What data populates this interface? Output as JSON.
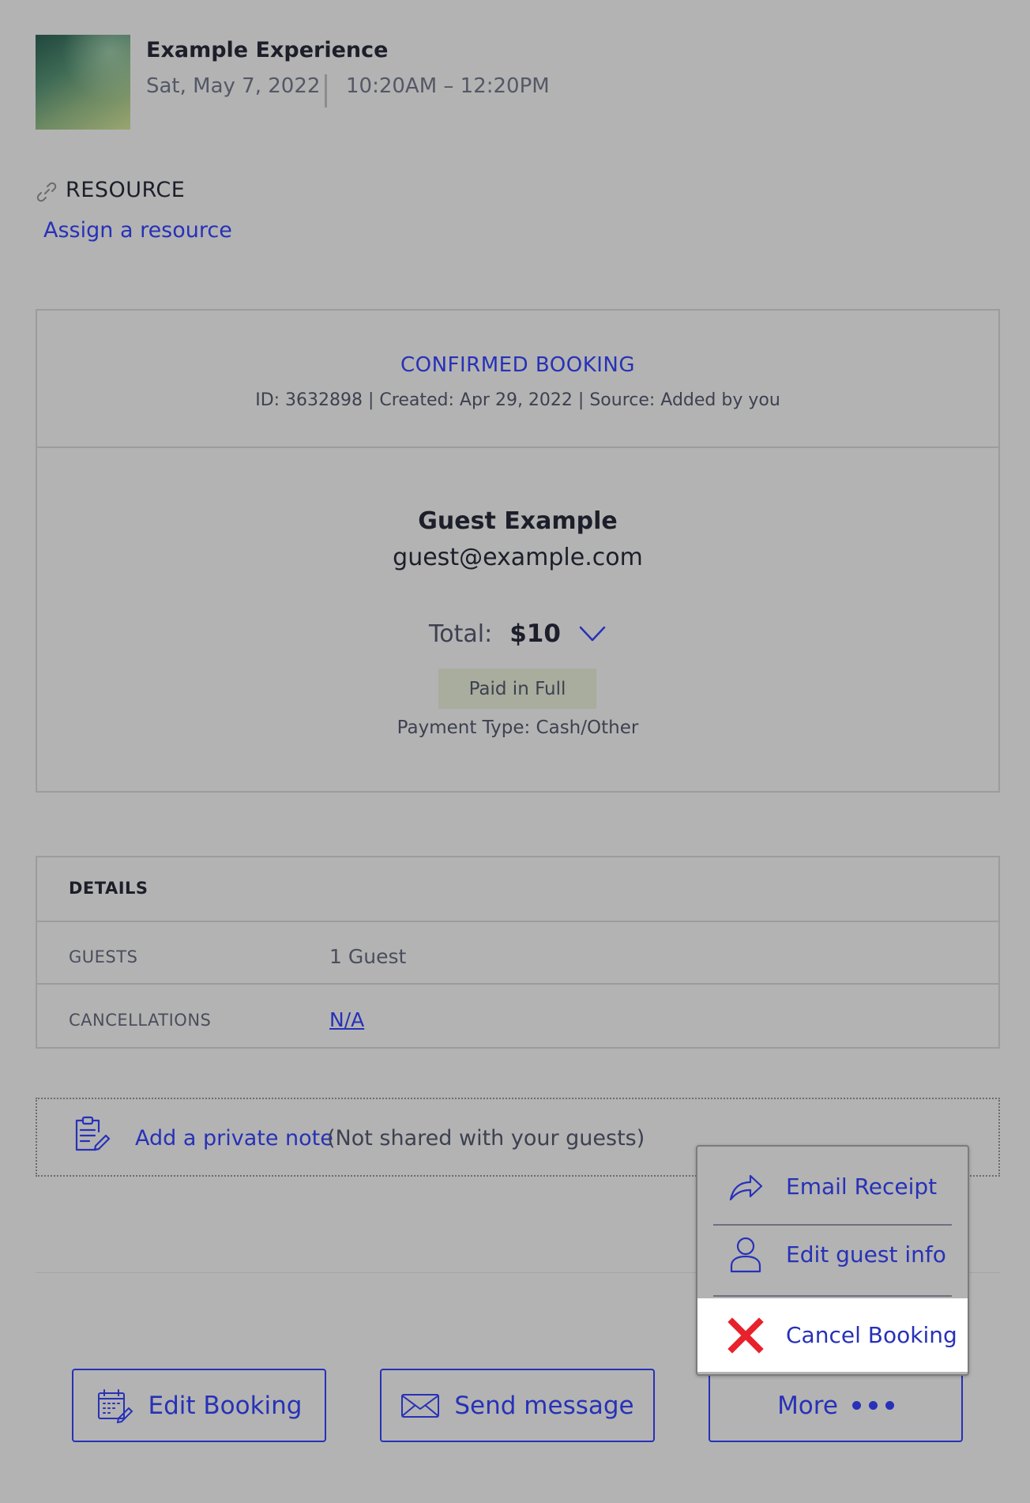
{
  "experience": {
    "title": "Example Experience",
    "date": "Sat, May 7, 2022",
    "time": "10:20AM – 12:20PM"
  },
  "resource": {
    "label": "RESOURCE",
    "link": "Assign a resource"
  },
  "booking": {
    "status": "CONFIRMED BOOKING",
    "meta": "ID: 3632898 | Created: Apr 29, 2022 | Source: Added by you",
    "guest_name": "Guest Example",
    "guest_email": "guest@example.com",
    "total_label": "Total:",
    "total_value": "$10",
    "paid_badge": "Paid in Full",
    "payment_type": "Payment Type: Cash/Other"
  },
  "details": {
    "header": "DETAILS",
    "rows": [
      {
        "label": "GUESTS",
        "value": "1 Guest"
      },
      {
        "label": "CANCELLATIONS",
        "value": "N/A"
      }
    ]
  },
  "note": {
    "link": "Add a private note",
    "hint": "(Not shared with your guests)"
  },
  "actions": {
    "edit": "Edit Booking",
    "send": "Send message",
    "more": "More"
  },
  "menu": {
    "items": [
      {
        "label": "Email Receipt",
        "icon": "share-arrow-icon"
      },
      {
        "label": "Edit guest info",
        "icon": "person-icon"
      },
      {
        "label": "Cancel Booking",
        "icon": "red-x-icon"
      }
    ]
  },
  "colors": {
    "accent": "#2731b8",
    "background": "#b3b3b3",
    "cancel_icon": "#e8212b"
  }
}
